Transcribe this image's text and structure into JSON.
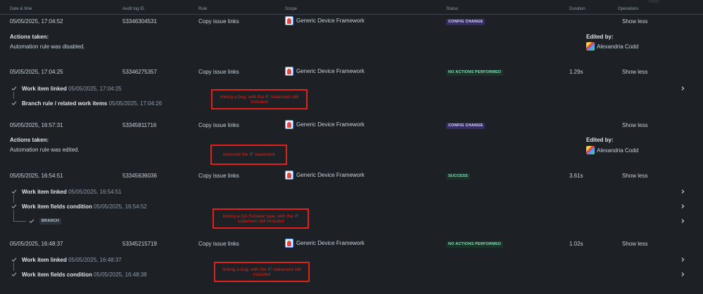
{
  "columns": {
    "date": "Date & time",
    "audit": "Audit log ID",
    "rule": "Rule",
    "scope": "Scope",
    "status": "Status",
    "duration": "Duration",
    "operations": "Operations"
  },
  "rows": [
    {
      "date": "05/05/2025, 17:04:52",
      "audit_id": "53346304531",
      "rule": "Copy issue links",
      "scope": "Generic Device Framework",
      "status": "CONFIG CHANGE",
      "duration": "",
      "operation": "Show less",
      "actions_label": "Actions taken:",
      "actions_text": "Automation rule was disabled.",
      "edited_label": "Edited by:",
      "editor": "Alexandria Codd"
    },
    {
      "date": "05/05/2025, 17:04:25",
      "audit_id": "53346275357",
      "rule": "Copy issue links",
      "scope": "Generic Device Framework",
      "status": "NO ACTIONS PERFORMED",
      "duration": "1.29s",
      "operation": "Show less",
      "steps": [
        {
          "label": "Work item linked",
          "time": "05/05/2025, 17:04:25"
        },
        {
          "label": "Branch rule / related work items",
          "time": "05/05/2025, 17:04:26"
        }
      ],
      "note": "linking a bug, with the IF statement still included"
    },
    {
      "date": "05/05/2025, 16:57:31",
      "audit_id": "53345811716",
      "rule": "Copy issue links",
      "scope": "Generic Device Framework",
      "status": "CONFIG CHANGE",
      "duration": "",
      "operation": "Show less",
      "actions_label": "Actions taken:",
      "actions_text": "Automation rule was edited.",
      "edited_label": "Edited by:",
      "editor": "Alexandria Codd",
      "note": "removed the IF staetment"
    },
    {
      "date": "05/05/2025, 16:54:51",
      "audit_id": "53345636036",
      "rule": "Copy issue links",
      "scope": "Generic Device Framework",
      "status": "SUCCESS",
      "duration": "3.61s",
      "operation": "Show less",
      "steps": [
        {
          "label": "Work item linked",
          "time": "05/05/2025, 16:54:51"
        },
        {
          "label": "Work item fields condition",
          "time": "05/05/2025, 16:54:52"
        }
      ],
      "branch": "BRANCH",
      "note": "linking a QA Subtask type, with the IF statement still included"
    },
    {
      "date": "05/05/2025, 16:48:37",
      "audit_id": "53345215719",
      "rule": "Copy issue links",
      "scope": "Generic Device Framework",
      "status": "NO ACTIONS PERFORMED",
      "duration": "1.02s",
      "operation": "Show less",
      "steps": [
        {
          "label": "Work item linked",
          "time": "05/05/2025, 16:48:37"
        },
        {
          "label": "Work item fields condition",
          "time": "05/05/2025, 16:48:38"
        }
      ],
      "note": "linking a bug, with the IF statement still included"
    }
  ],
  "icons": {
    "check": "check-icon",
    "chevron": "chevron-right-icon",
    "project": "project-avatar-icon",
    "user": "user-avatar"
  },
  "colors": {
    "background": "#1d2125",
    "annotation": "#e0221a",
    "config_change": "#352c63",
    "success": "#1c3329"
  }
}
